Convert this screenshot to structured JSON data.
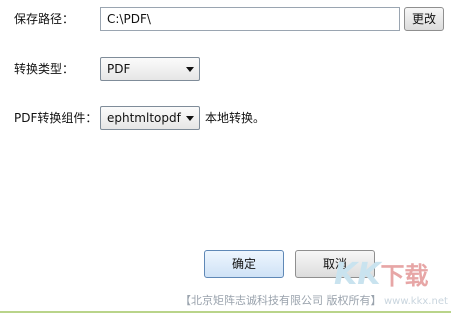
{
  "path_row": {
    "label": "保存路径：",
    "value": "C:\\PDF\\",
    "button": "更改"
  },
  "type_row": {
    "label": "转换类型：",
    "selected": "PDF"
  },
  "component_row": {
    "label": "PDF转换组件：",
    "selected": "ephtmltopdf",
    "note": "本地转换。"
  },
  "actions": {
    "ok": "确定",
    "cancel": "取消"
  },
  "footer": {
    "copyright": "【北京矩阵志诚科技有限公司 版权所有】"
  },
  "watermark": {
    "brand": "KK",
    "text": "下载",
    "site": "www.kkx.net"
  },
  "colors": {
    "ok_button_border": "#5f88b6",
    "footer_text": "#9aa3ad"
  }
}
